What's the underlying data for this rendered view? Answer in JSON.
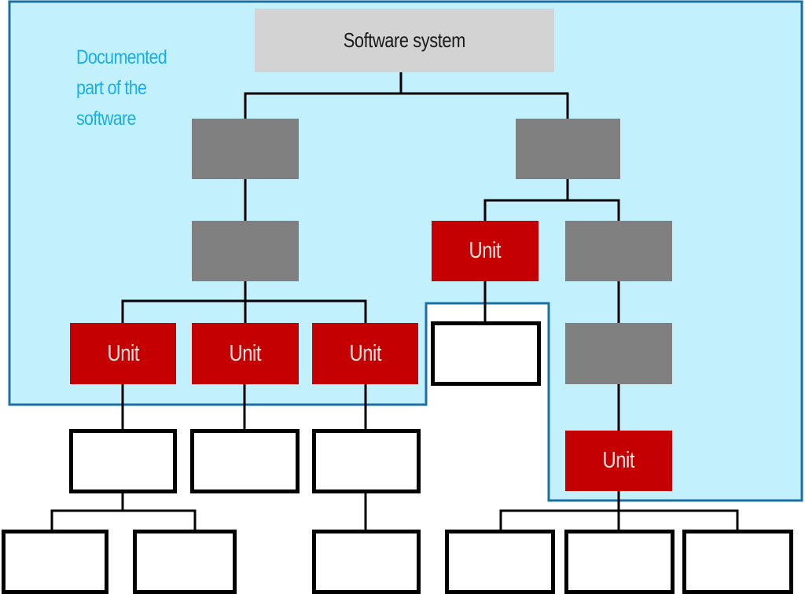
{
  "diagram": {
    "region_label": "Documented part of the software",
    "region_label_lines": [
      "Documented",
      "part of the",
      "software"
    ],
    "colors": {
      "region_fill": "#c3f0fd",
      "region_border": "#1a6fa5",
      "root_fill": "#d3d3d3",
      "module_fill": "#808080",
      "unit_fill": "#c40000",
      "unit_text": "#ffe4e4",
      "leaf_fill": "#ffffff",
      "connector": "#000000",
      "label_text": "#1aaee8"
    },
    "nodes": {
      "root": {
        "type": "root",
        "label": "Software system"
      },
      "module_left_1": {
        "type": "module",
        "label": ""
      },
      "module_left_2": {
        "type": "module",
        "label": ""
      },
      "module_right_1": {
        "type": "module",
        "label": ""
      },
      "module_right_2": {
        "type": "module",
        "label": ""
      },
      "module_right_3": {
        "type": "module",
        "label": ""
      },
      "unit_1": {
        "type": "unit",
        "label": "Unit"
      },
      "unit_2": {
        "type": "unit",
        "label": "Unit"
      },
      "unit_3": {
        "type": "unit",
        "label": "Unit"
      },
      "unit_4": {
        "type": "unit",
        "label": "Unit"
      },
      "unit_5": {
        "type": "unit",
        "label": "Unit"
      },
      "leaf_1": {
        "type": "leaf",
        "label": ""
      },
      "leaf_2": {
        "type": "leaf",
        "label": ""
      },
      "leaf_3": {
        "type": "leaf",
        "label": ""
      },
      "leaf_4": {
        "type": "leaf",
        "label": ""
      },
      "leaf_5": {
        "type": "leaf",
        "label": ""
      },
      "leaf_6": {
        "type": "leaf",
        "label": ""
      },
      "leaf_7": {
        "type": "leaf",
        "label": ""
      },
      "leaf_8": {
        "type": "leaf",
        "label": ""
      },
      "leaf_9": {
        "type": "leaf",
        "label": ""
      },
      "leaf_10": {
        "type": "leaf",
        "label": ""
      }
    },
    "edges": [
      [
        "root",
        "module_left_1"
      ],
      [
        "root",
        "module_right_1"
      ],
      [
        "module_left_1",
        "module_left_2"
      ],
      [
        "module_left_2",
        "unit_1"
      ],
      [
        "module_left_2",
        "unit_2"
      ],
      [
        "module_left_2",
        "unit_3"
      ],
      [
        "module_right_1",
        "unit_4"
      ],
      [
        "module_right_1",
        "module_right_2"
      ],
      [
        "unit_4",
        "leaf_4"
      ],
      [
        "module_right_2",
        "module_right_3"
      ],
      [
        "module_right_3",
        "unit_5"
      ],
      [
        "unit_1",
        "leaf_1"
      ],
      [
        "unit_2",
        "leaf_2"
      ],
      [
        "unit_3",
        "leaf_3"
      ],
      [
        "leaf_1",
        "leaf_5"
      ],
      [
        "leaf_1",
        "leaf_6"
      ],
      [
        "leaf_3",
        "leaf_7"
      ],
      [
        "unit_5",
        "leaf_8"
      ],
      [
        "unit_5",
        "leaf_9"
      ],
      [
        "unit_5",
        "leaf_10"
      ]
    ]
  }
}
